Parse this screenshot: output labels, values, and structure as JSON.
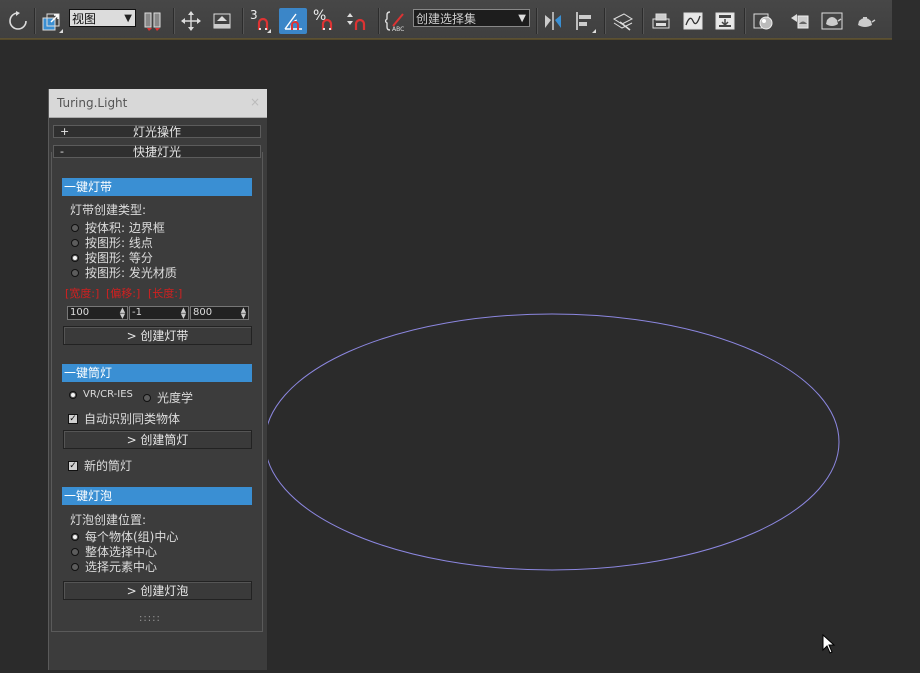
{
  "toolbar": {
    "view_dropdown": "视图",
    "snap_number": "3",
    "percent_symbol": "%",
    "selection_set": "创建选择集",
    "icons": [
      "refresh-icon",
      "select-scale-icon",
      "view-dropdown",
      "layer-filter-icon",
      "move-icon",
      "place-icon",
      "snap-toggle-icon",
      "angle-snap-icon",
      "percent-snap-icon",
      "spinner-snap-icon",
      "edit-named-sets-icon",
      "selection-set-dropdown",
      "mirror-icon",
      "align-icon",
      "layers-icon",
      "render-setup-icon",
      "curve-editor-icon",
      "schematic-icon",
      "material-editor-icon",
      "render-frame-icon",
      "render-icon",
      "teapot-icon",
      "teapot-active-icon"
    ]
  },
  "panel": {
    "title": "Turing.Light",
    "close": "×",
    "rollout1": {
      "sign": "+",
      "label": "灯光操作"
    },
    "rollout2": {
      "sign": "-",
      "label": "快捷灯光"
    },
    "strip": {
      "header": "一键灯带",
      "type_label": "灯带创建类型:",
      "options": [
        "按体积: 边界框",
        "按图形: 线点",
        "按图形: 等分",
        "按图形: 发光材质"
      ],
      "selected": 2,
      "warn_labels": [
        "[宽度:]",
        "[偏移:]",
        "[长度:]"
      ],
      "spinners": [
        "100",
        "-1",
        "800"
      ],
      "button": "> 创建灯带"
    },
    "spot": {
      "header": "一键筒灯",
      "radio_options": [
        "VR/CR-IES",
        "光度学"
      ],
      "selected": 0,
      "check1": "自动识别同类物体",
      "check1_on": true,
      "button": "> 创建筒灯",
      "check2": "新的筒灯",
      "check2_on": true
    },
    "bulb": {
      "header": "一键灯泡",
      "pos_label": "灯泡创建位置:",
      "options": [
        "每个物体(组)中心",
        "整体选择中心",
        "选择元素中心"
      ],
      "selected": 0,
      "button": "> 创建灯泡"
    },
    "grip": ":::::"
  },
  "viewport": {
    "background": "#2b2b2b",
    "ellipse_color": "#8c87e0"
  }
}
